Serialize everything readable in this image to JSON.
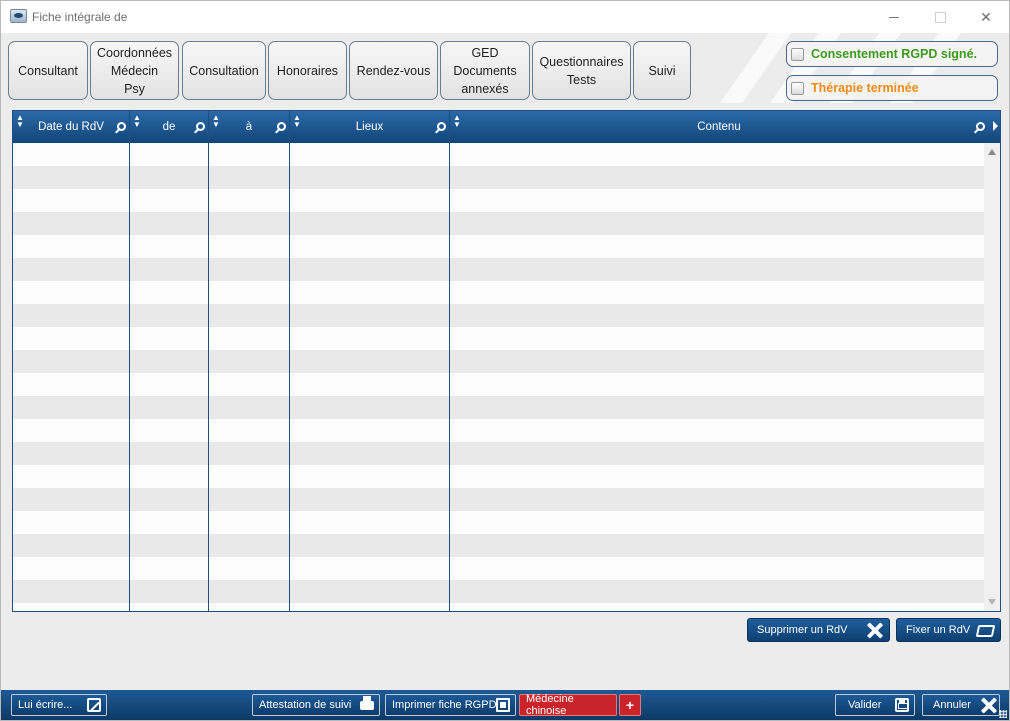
{
  "window": {
    "title": "Fiche intégrale de"
  },
  "tabs": [
    {
      "label": "Consultant"
    },
    {
      "label": "Coordonnées\nMédecin\nPsy"
    },
    {
      "label": "Consultation"
    },
    {
      "label": "Honoraires"
    },
    {
      "label": "Rendez-vous"
    },
    {
      "label": "GED\nDocuments\nannexés"
    },
    {
      "label": "Questionnaires\nTests"
    },
    {
      "label": "Suivi"
    }
  ],
  "checks": {
    "rgpd": {
      "label": "Consentement RGPD signé.",
      "checked": false,
      "color": "#3f9a1c"
    },
    "therapie": {
      "label": "Thérapie terminée",
      "checked": false,
      "color": "#f08a12"
    }
  },
  "grid": {
    "columns": [
      "Date du RdV",
      "de",
      "à",
      "Lieux",
      "Contenu"
    ],
    "rows": []
  },
  "actions": {
    "delete": "Supprimer un RdV",
    "fix": "Fixer un RdV"
  },
  "footer": {
    "write": "Lui écrire...",
    "attestation": "Attestation de suivi",
    "print_rgpd": "Imprimer fiche RGPD",
    "chinese": "Médecine chinoise",
    "plus": "+",
    "validate": "Valider",
    "cancel": "Annuler"
  },
  "colors": {
    "header_blue": "#12467a",
    "accent_red": "#c8242a"
  }
}
